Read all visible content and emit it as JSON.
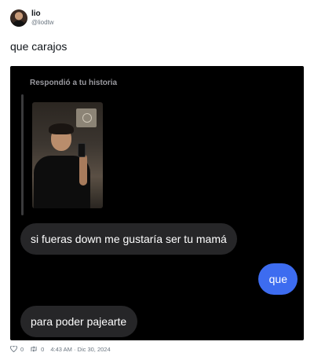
{
  "author": {
    "display_name": "lio",
    "handle": "@liodtw"
  },
  "tweet": {
    "text": "que carajos"
  },
  "story_reply": {
    "label": "Respondió a tu historia",
    "messages": [
      {
        "direction": "received",
        "text": "si fueras down me gustaría ser tu mamá"
      },
      {
        "direction": "sent",
        "text": "que"
      },
      {
        "direction": "received",
        "text": "para poder pajearte"
      }
    ]
  },
  "footer": {
    "likes": "0",
    "retweets": "0",
    "timestamp": "4:43 AM · Dic 30, 2024"
  },
  "icons": {
    "like": "heart-icon",
    "retweet": "retweet-icon"
  },
  "colors": {
    "sent_bubble": "#3d6cf0",
    "received_bubble": "#262628",
    "dm_background": "#000000"
  }
}
